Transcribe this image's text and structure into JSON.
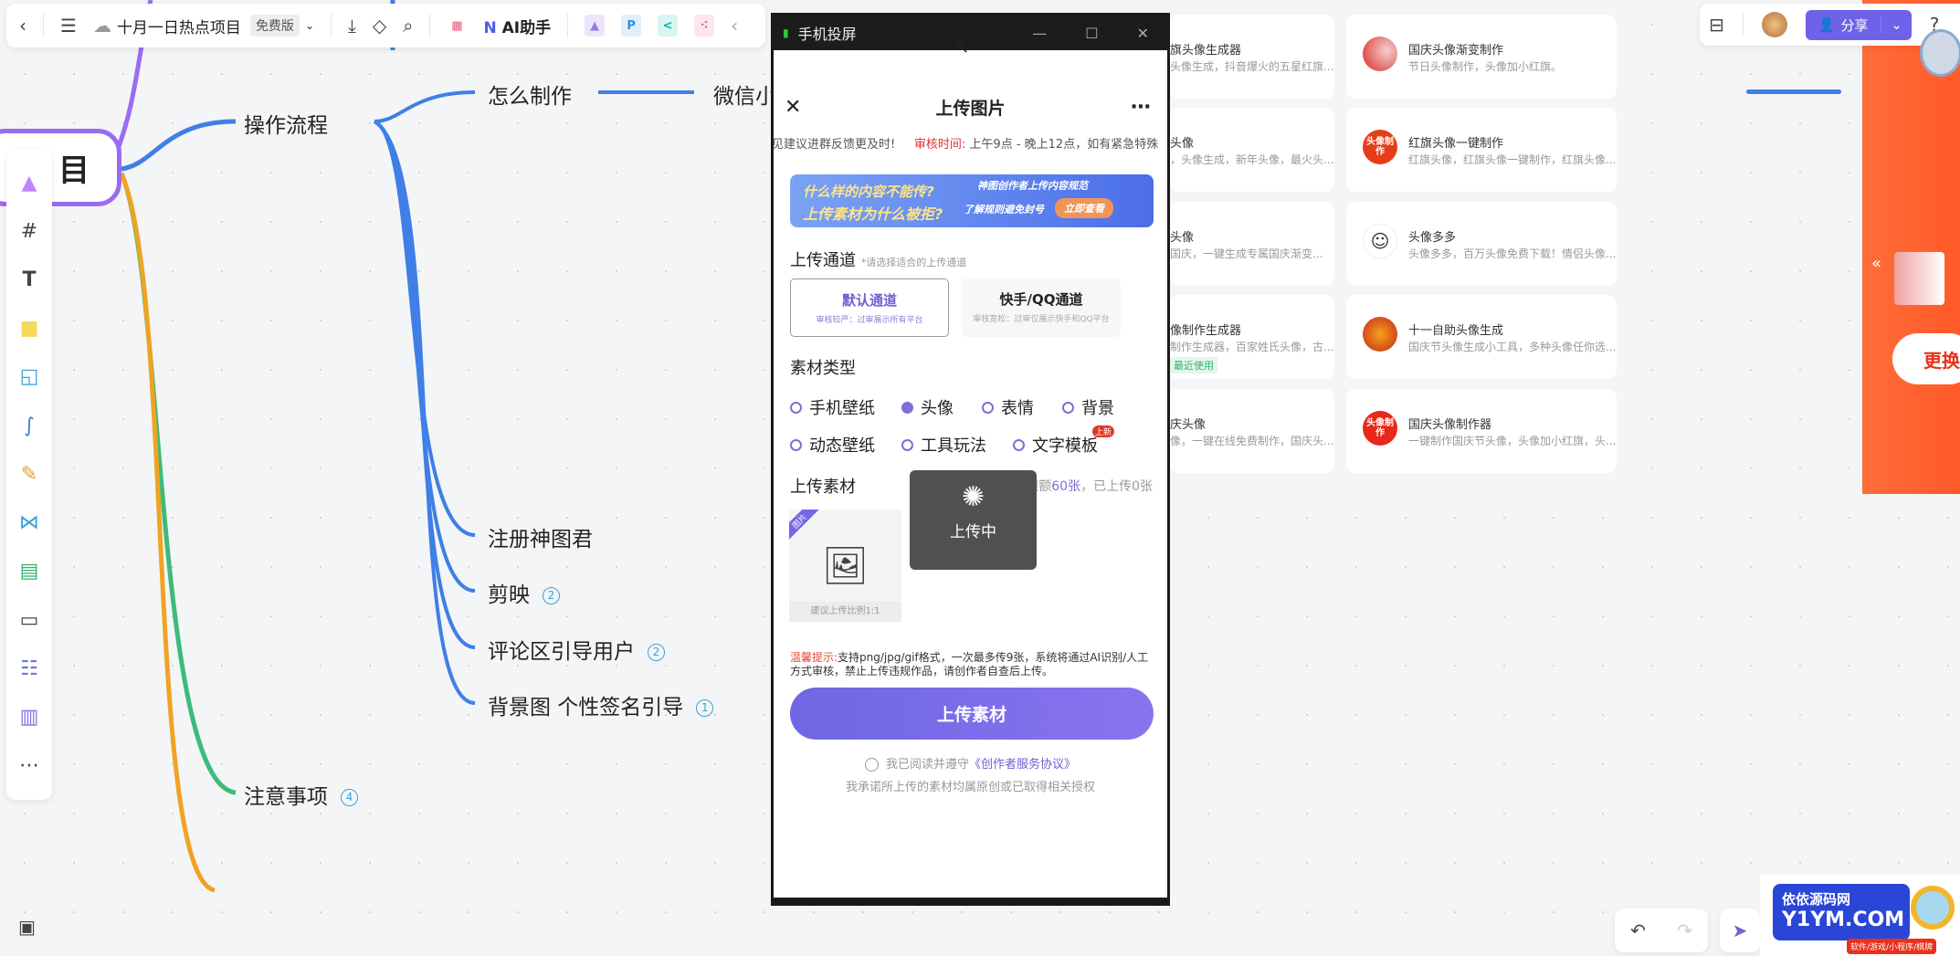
{
  "topbar": {
    "title": "十月一日热点项目",
    "plan_badge": "免费版",
    "ai_label": "AI助手",
    "icons": [
      "back-icon",
      "menu-icon",
      "cloud-icon",
      "download-icon",
      "tag-icon",
      "search-icon",
      "calendar-icon",
      "ai-icon",
      "image-plugin-icon",
      "p-plugin-icon",
      "share-plugin-icon",
      "flow-plugin-icon",
      "collapse-icon"
    ]
  },
  "right_toolbar": {
    "share_label": "分享",
    "icons": [
      "toolbox-icon",
      "avatar",
      "share-user-icon",
      "chevron-down-icon",
      "help-icon"
    ]
  },
  "mindmap": {
    "root": "目",
    "branch1": "操作流程",
    "child_how": "怎么制作",
    "child_wechat": "微信小",
    "children": [
      {
        "label": "注册神图君"
      },
      {
        "label": "剪映",
        "count": "2"
      },
      {
        "label": "评论区引导用户",
        "count": "2"
      },
      {
        "label": "背景图 个性签名引导",
        "count": "1"
      }
    ],
    "branch2": "注意事项",
    "branch2_count": "4",
    "colors": {
      "purple": "#9b6bf2",
      "blue": "#3f7fe6",
      "green": "#3dbb7a",
      "orange": "#f0a323"
    }
  },
  "left_tools": [
    "sticker-icon",
    "frame-icon",
    "text-icon",
    "note-icon",
    "shape-icon",
    "connector-icon",
    "pen-icon",
    "mindmap-icon",
    "table-icon",
    "doc-icon",
    "list-icon",
    "kanban-icon",
    "more-icon"
  ],
  "phone": {
    "window_title": "手机投屏",
    "page_title": "上传图片",
    "notice_left": "见建议进群反馈更及时!",
    "notice_label": "审核时间:",
    "notice_text": "上午9点 - 晚上12点，如有紧急特殊",
    "banner_line1": "什么样的内容不能传?",
    "banner_line2": "上传素材为什么被拒?",
    "banner_top": "神图创作者上传内容规范",
    "banner_cta": "了解规则避免封号",
    "banner_btn": "立即查看",
    "channel_title": "上传通道",
    "channel_hint": "*请选择适合的上传通道",
    "channels": [
      {
        "name": "默认通道",
        "desc": "审核较严：过审展示所有平台",
        "selected": true
      },
      {
        "name": "快手/QQ通道",
        "desc": "审核宽松：过审仅展示快手和QQ平台",
        "selected": false
      }
    ],
    "type_title": "素材类型",
    "types": [
      {
        "label": "手机壁纸",
        "selected": false
      },
      {
        "label": "头像",
        "selected": true
      },
      {
        "label": "表情",
        "selected": false
      },
      {
        "label": "背景",
        "selected": false
      },
      {
        "label": "动态壁纸",
        "selected": false
      },
      {
        "label": "工具玩法",
        "selected": false
      },
      {
        "label": "文字模板",
        "selected": false,
        "badge": "上新"
      }
    ],
    "upload_title": "上传素材",
    "quota_prefix": "今日限额",
    "quota_value": "60张",
    "quota_suffix": "，已上传0张",
    "tile_tag": "图片",
    "tile_hint": "建议上传比例1:1",
    "loading_text": "上传中",
    "tip_label": "温馨提示:",
    "tip_text": "支持png/jpg/gif格式，一次最多传9张，系统将通过AI识别/人工方式审核，禁止上传违规作品，请创作者自查后上传。",
    "upload_button": "上传素材",
    "agree_prefix": "我已阅读并遵守",
    "agree_link": "《创作者服务协议》",
    "promise": "我承诺所上传的素材均属原创或已取得相关授权",
    "accent": "#7367e6"
  },
  "cards_left": [
    {
      "title": "旗头像生成器",
      "desc": "头像生成，抖音爆火的五星红旗..."
    },
    {
      "title": "头像",
      "desc": "，头像生成，新年头像，最火头..."
    },
    {
      "title": "头像",
      "desc": "国庆，一键生成专属国庆渐变..."
    },
    {
      "title": "像制作生成器",
      "desc": "制作生成器，百家姓氏头像，古...",
      "tag": "最近使用"
    },
    {
      "title": "庆头像",
      "desc": "像，一键在线免费制作，国庆头..."
    }
  ],
  "cards_right": [
    {
      "title": "国庆头像渐变制作",
      "desc": "节日头像制作，头像加小红旗。",
      "avatar": ""
    },
    {
      "title": "红旗头像一键制作",
      "desc": "红旗头像，红旗头像一键制作，红旗头像...",
      "avatar": "头像制作"
    },
    {
      "title": "头像多多",
      "desc": "头像多多，百万头像免费下载！情侣头像...",
      "avatar": ""
    },
    {
      "title": "十一自助头像生成",
      "desc": "国庆节头像生成小工具，多种头像任你选...",
      "avatar": ""
    },
    {
      "title": "国庆头像制作器",
      "desc": "一键制作国庆节头像，头像加小红旗，头...",
      "avatar": "头像制作"
    }
  ],
  "orange_panel": {
    "button": "更换"
  },
  "watermark": {
    "line1": "依依源码网",
    "line2": "Y1YM.COM",
    "line3": "软件/游戏/小程序/棋牌"
  }
}
